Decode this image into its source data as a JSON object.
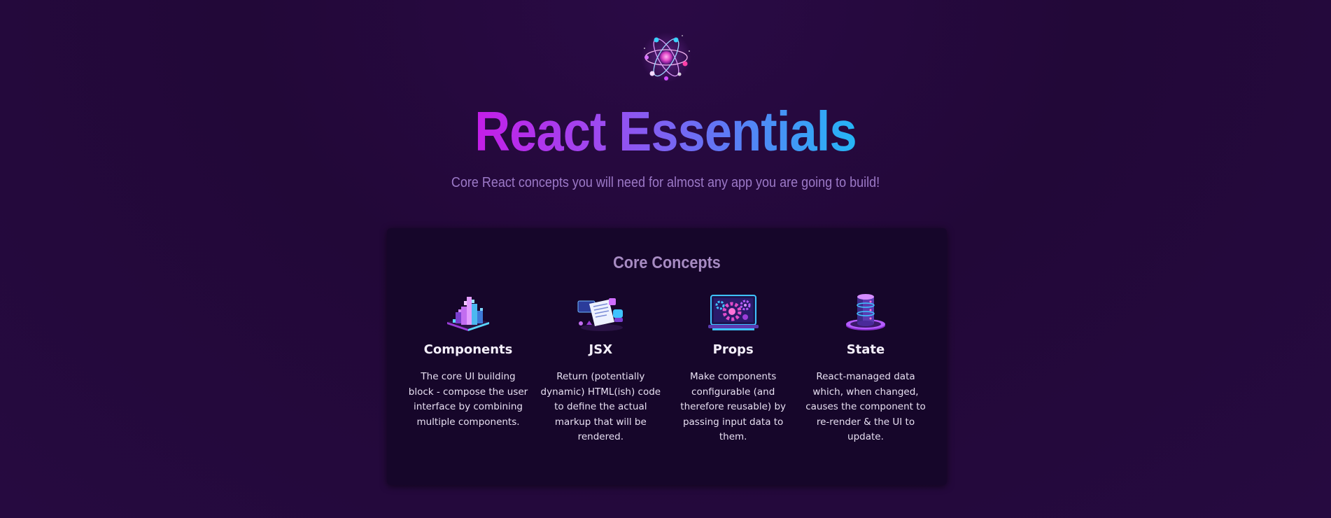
{
  "header": {
    "logo_icon": "atom-icon",
    "title": "React Essentials",
    "subtitle": "Core React concepts you will need for almost any app you are going to build!"
  },
  "core_concepts": {
    "heading": "Core Concepts",
    "items": [
      {
        "icon": "components-blocks-icon",
        "title": "Components",
        "description": "The core UI building block - compose the user interface by combining multiple components."
      },
      {
        "icon": "jsx-document-icon",
        "title": "JSX",
        "description": "Return (potentially dynamic) HTML(ish) code to define the actual markup that will be rendered."
      },
      {
        "icon": "props-gears-icon",
        "title": "Props",
        "description": "Make components configurable (and therefore reusable) by passing input data to them."
      },
      {
        "icon": "state-database-icon",
        "title": "State",
        "description": "React-managed data which, when changed, causes the component to re-render & the UI to update."
      }
    ]
  },
  "colors": {
    "background": "#220838",
    "panel": "#16062a",
    "title_gradient_start": "#c41de8",
    "title_gradient_end": "#25b6f6",
    "subtitle": "#9c79c7",
    "panel_heading": "#a78bc2"
  }
}
